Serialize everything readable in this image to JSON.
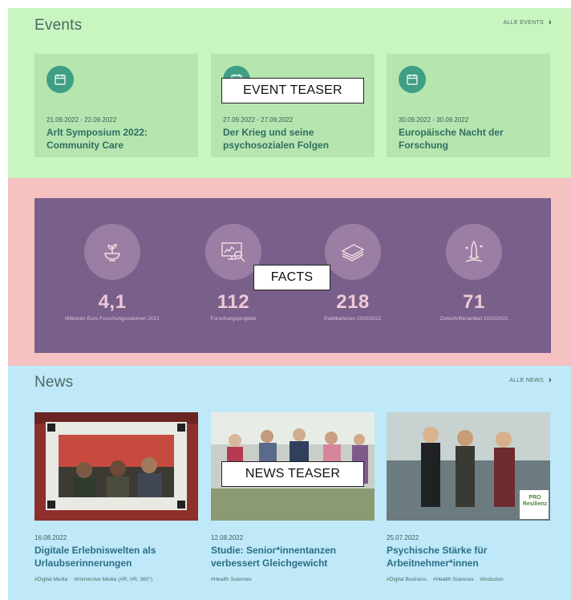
{
  "events": {
    "title": "Events",
    "all_link": "ALLE EVENTS",
    "overlay_label": "EVENT TEASER",
    "cards": [
      {
        "date": "21.09.2022 - 22.09.2022",
        "title": "Arlt Symposium 2022: Community Care",
        "icon": "calendar-icon"
      },
      {
        "date": "27.09.2022 - 27.09.2022",
        "title": "Der Krieg und seine psychosozialen Folgen",
        "icon": "calendar-icon"
      },
      {
        "date": "30.09.2022 - 30.09.2022",
        "title": "Europäische Nacht der Forschung",
        "icon": "calendar-icon"
      }
    ]
  },
  "facts": {
    "overlay_label": "FACTS",
    "items": [
      {
        "number": "4,1",
        "label": "Millionen Euro Forschungsvolumen 2021",
        "icon": "plant-bowl-icon"
      },
      {
        "number": "112",
        "label": "Forschungsprojekte",
        "icon": "monitor-magnifier-icon"
      },
      {
        "number": "218",
        "label": "Publikationen 2020/2021",
        "icon": "paper-stack-icon"
      },
      {
        "number": "71",
        "label": "Zeitschriftenartikel 2020/2021",
        "icon": "rocket-icon"
      }
    ]
  },
  "news": {
    "title": "News",
    "all_link": "ALLE NEWS",
    "overlay_label": "NEWS TEASER",
    "cards": [
      {
        "date": "16.08.2022",
        "title": "Digitale Erlebniswelten als Urlaubserinnerungen",
        "tags": [
          "#Digital Media",
          "#Immersive Media (AR, VR, 360°)"
        ]
      },
      {
        "date": "12.08.2022",
        "title": "Studie: Senior*innentanzen verbessert Gleichgewicht",
        "tags": [
          "#Health Sciences"
        ]
      },
      {
        "date": "25.07.2022",
        "title": "Psychische Stärke für Arbeitnehmer*innen",
        "tags": [
          "#Digital Business",
          "#Health Sciences",
          "#Inclusion"
        ],
        "badge": "PRO Resilienz"
      }
    ]
  },
  "colors": {
    "events_bg": "#c9f5c1",
    "facts_bg": "#f5c1c1",
    "facts_panel": "#78608a",
    "news_bg": "#bfe9f9",
    "accent": "#3f9e84"
  }
}
